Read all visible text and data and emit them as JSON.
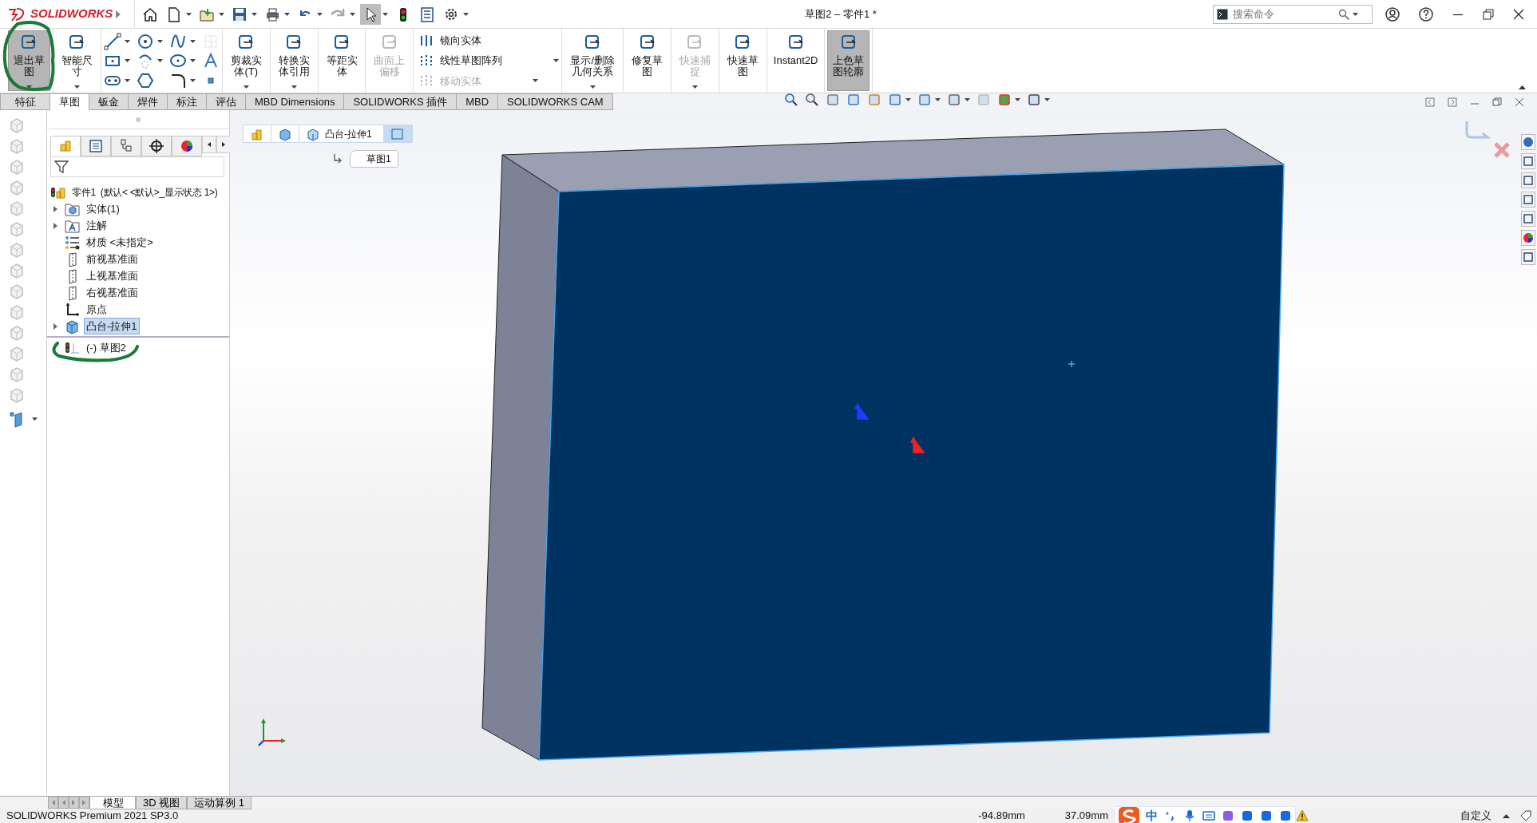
{
  "title_bar": {
    "logo": "SOLIDWORKS",
    "title": "草图2 – 零件1 *",
    "search": {
      "placeholder": "搜索命令"
    }
  },
  "ribbon": {
    "items": [
      {
        "kind": "large",
        "label": "退出草图",
        "selected": true,
        "disabled": false,
        "dropdown": true
      },
      {
        "kind": "large",
        "label": "智能尺寸",
        "selected": false,
        "disabled": false,
        "dropdown": true
      },
      {
        "kind": "tools"
      },
      {
        "kind": "large",
        "label": "剪裁实体(T)",
        "selected": false,
        "disabled": false,
        "dropdown": true
      },
      {
        "kind": "large",
        "label": "转换实体引用",
        "selected": false,
        "disabled": false,
        "dropdown": true
      },
      {
        "kind": "large",
        "label": "等距实体",
        "selected": false,
        "disabled": false,
        "dropdown": false
      },
      {
        "kind": "large",
        "label": "曲面上偏移",
        "selected": false,
        "disabled": true,
        "dropdown": false
      },
      {
        "kind": "stack",
        "entries": [
          {
            "label": "镜向实体",
            "disabled": false,
            "dropdown": false
          },
          {
            "label": "线性草图阵列",
            "disabled": false,
            "dropdown": true
          },
          {
            "label": "移动实体",
            "disabled": true,
            "dropdown": true
          }
        ]
      },
      {
        "kind": "large",
        "label": "显示/删除几何关系",
        "selected": false,
        "disabled": false,
        "dropdown": true
      },
      {
        "kind": "large",
        "label": "修复草图",
        "selected": false,
        "disabled": false,
        "dropdown": false
      },
      {
        "kind": "large",
        "label": "快速捕捉",
        "selected": false,
        "disabled": true,
        "dropdown": true
      },
      {
        "kind": "large",
        "label": "快速草图",
        "selected": false,
        "disabled": false,
        "dropdown": false
      },
      {
        "kind": "large",
        "label": "Instant2D",
        "selected": false,
        "disabled": false,
        "dropdown": false
      },
      {
        "kind": "large",
        "label": "上色草图轮廓",
        "selected": true,
        "disabled": false,
        "dropdown": false
      }
    ]
  },
  "tabs": [
    {
      "label": "特征",
      "selected": false
    },
    {
      "label": "草图",
      "selected": true
    },
    {
      "label": "钣金",
      "selected": false
    },
    {
      "label": "焊件",
      "selected": false
    },
    {
      "label": "标注",
      "selected": false
    },
    {
      "label": "评估",
      "selected": false
    },
    {
      "label": "MBD Dimensions",
      "selected": false
    },
    {
      "label": "SOLIDWORKS 插件",
      "selected": false
    },
    {
      "label": "MBD",
      "selected": false
    },
    {
      "label": "SOLIDWORKS CAM",
      "selected": false
    }
  ],
  "feature_tree": {
    "root": {
      "label": "零件1  (默认< <默认>_显示状态 1>)"
    },
    "children": [
      {
        "label": "实体(1)",
        "kind": "solid-folder",
        "expandable": true,
        "selected": false
      },
      {
        "label": "注解",
        "kind": "annotation-folder",
        "expandable": true,
        "selected": false
      },
      {
        "label": "材质 <未指定>",
        "kind": "material",
        "expandable": false,
        "selected": false
      },
      {
        "label": "前视基准面",
        "kind": "plane",
        "expandable": false,
        "selected": false
      },
      {
        "label": "上视基准面",
        "kind": "plane",
        "expandable": false,
        "selected": false
      },
      {
        "label": "右视基准面",
        "kind": "plane",
        "expandable": false,
        "selected": false
      },
      {
        "label": "原点",
        "kind": "origin",
        "expandable": false,
        "selected": false
      },
      {
        "label": "凸台-拉伸1",
        "kind": "feature",
        "expandable": true,
        "selected": true
      }
    ],
    "rolled_back": [
      {
        "label": "(-) 草图2",
        "kind": "sketch",
        "selected": false
      }
    ]
  },
  "breadcrumb": {
    "items": [
      {
        "kind": "part"
      },
      {
        "kind": "body"
      },
      {
        "kind": "feature",
        "label": "凸台-拉伸1"
      },
      {
        "kind": "plane"
      }
    ],
    "sub": {
      "label": "草图1"
    }
  },
  "bottom_tabs": [
    {
      "label": "模型",
      "selected": true
    },
    {
      "label": "3D 视图",
      "selected": false
    },
    {
      "label": "运动算例 1",
      "selected": false
    }
  ],
  "status_bar": {
    "product": "SOLIDWORKS Premium 2021 SP3.0",
    "x": "-94.89mm",
    "y": "37.09mm",
    "units": "自定义",
    "ime_mode": "中"
  }
}
